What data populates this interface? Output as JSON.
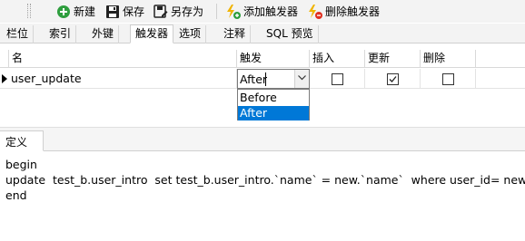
{
  "toolbar": {
    "new_label": "新建",
    "save_label": "保存",
    "save_as_label": "另存为",
    "add_trigger_label": "添加触发器",
    "delete_trigger_label": "删除触发器"
  },
  "tabs": [
    {
      "label": "栏位"
    },
    {
      "label": "索引"
    },
    {
      "label": "外键"
    },
    {
      "label": "触发器",
      "active": true
    },
    {
      "label": "选项"
    },
    {
      "label": "注释"
    },
    {
      "label": "SQL 预览"
    }
  ],
  "grid": {
    "headers": {
      "name": "名",
      "fires": "触发",
      "insert": "插入",
      "update": "更新",
      "delete": "删除"
    },
    "rows": [
      {
        "name": "user_update",
        "fires": "After",
        "insert": false,
        "update": true,
        "delete": false
      }
    ]
  },
  "dropdown": {
    "options": [
      "Before",
      "After"
    ],
    "selected": "After"
  },
  "definition": {
    "tab_label": "定义",
    "code_lines": [
      "begin",
      "update  test_b.user_intro  set test_b.user_intro.`name` = new.`name`  where user_id= new.id;",
      "end"
    ]
  },
  "colors": {
    "selection": "#0078d7",
    "toolbar_bg": "#f3f3f3",
    "new_icon": "#2e9e3e",
    "add_trigger_icon": "#f0b400",
    "delete_trigger_icon": "#e03020"
  },
  "icons": {
    "new": "plus-circle-icon",
    "save": "floppy-disk-icon",
    "save_as": "save-as-icon",
    "add_trigger": "lightning-add-icon",
    "delete_trigger": "lightning-delete-icon"
  }
}
